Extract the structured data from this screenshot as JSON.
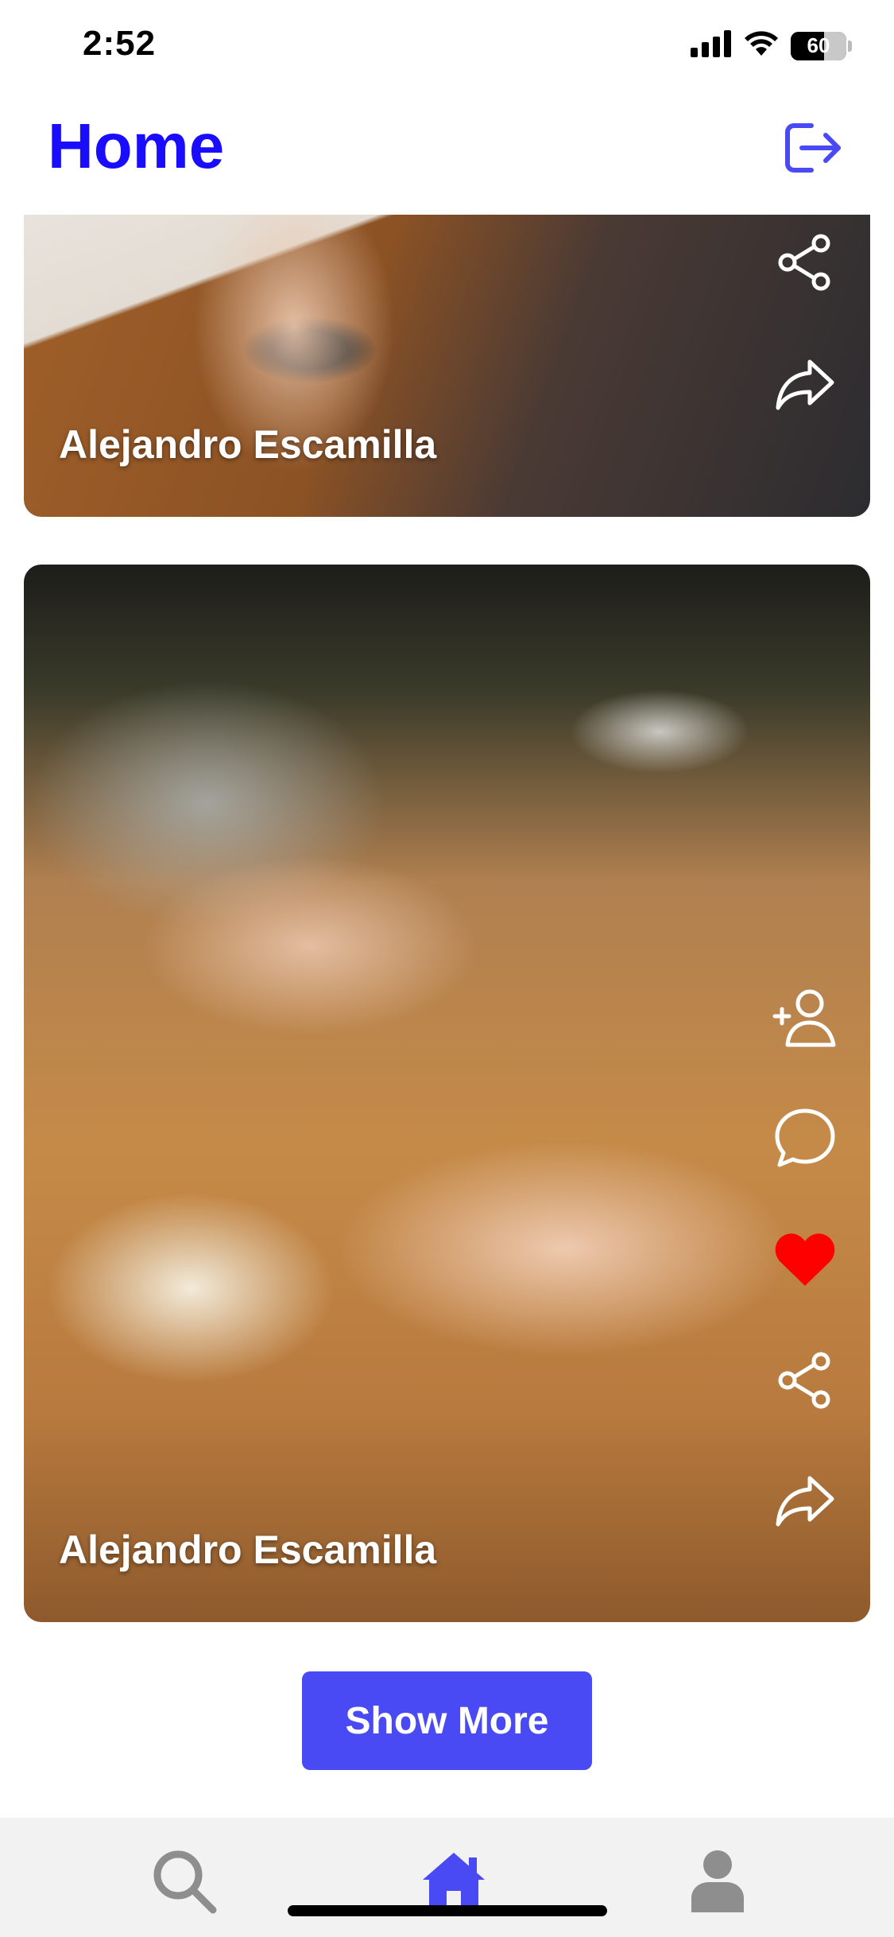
{
  "status_bar": {
    "time": "2:52",
    "battery": "60",
    "icons": [
      "cellular-signal-icon",
      "wifi-icon",
      "battery-icon"
    ],
    "battery_level": 0.6
  },
  "header": {
    "title": "Home",
    "logout_icon": "logout-icon"
  },
  "colors": {
    "accent": "#1a0dff",
    "button": "#4a4af4",
    "like": "#ff0000",
    "tab_active": "#4a4af4",
    "tab_inactive": "#8e8e8e",
    "tab_bar_bg": "#f2f2f2"
  },
  "feed": {
    "posts": [
      {
        "author": "Alejandro Escamilla",
        "actions": [
          "share-icon",
          "forward-icon"
        ]
      },
      {
        "author": "Alejandro Escamilla",
        "actions": [
          "add-user-icon",
          "comment-icon",
          "heart-icon",
          "share-icon",
          "forward-icon"
        ],
        "liked": true
      }
    ]
  },
  "show_more": {
    "label": "Show More"
  },
  "tab_bar": {
    "items": [
      {
        "name": "search",
        "icon": "search-icon",
        "active": false
      },
      {
        "name": "home",
        "icon": "home-icon",
        "active": true
      },
      {
        "name": "profile",
        "icon": "user-icon",
        "active": false
      }
    ]
  }
}
